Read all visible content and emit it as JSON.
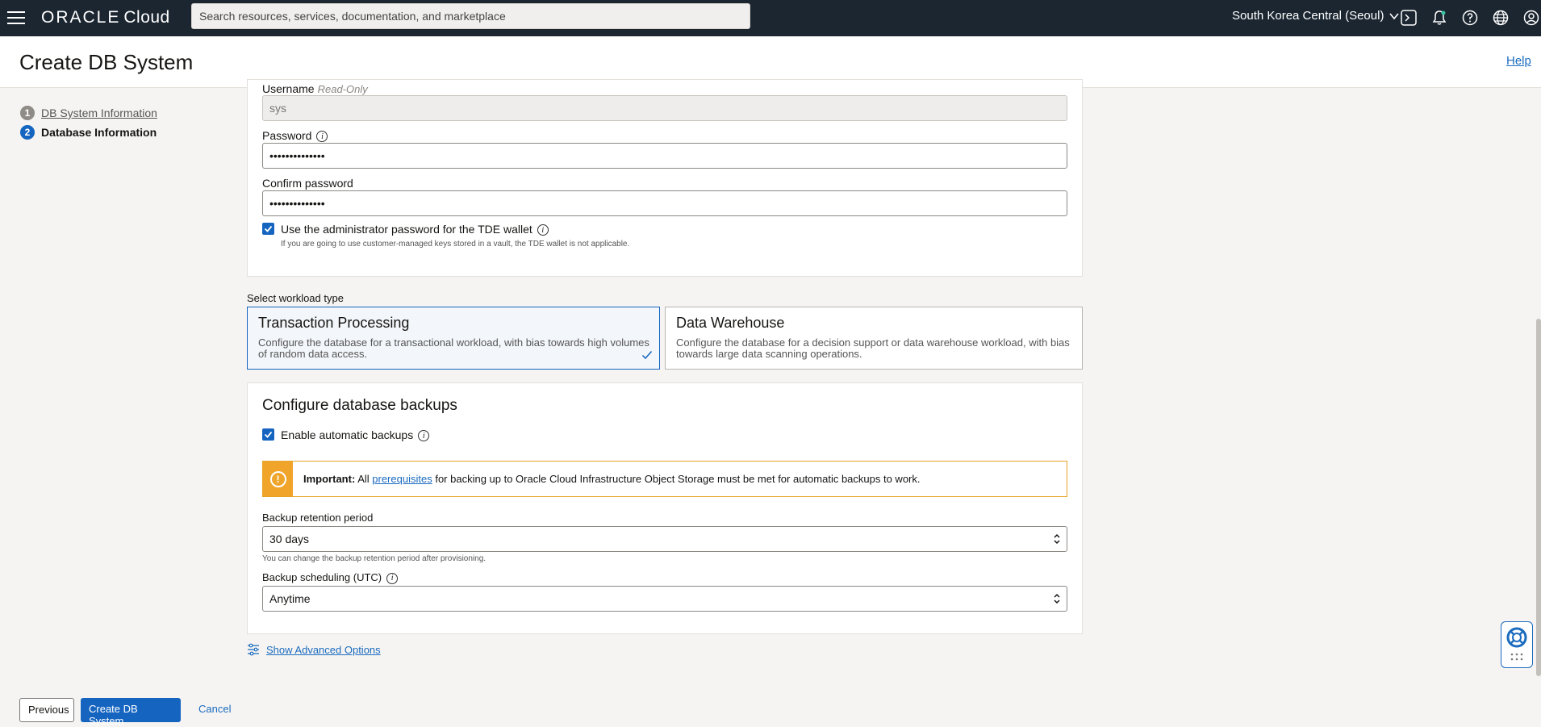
{
  "topbar": {
    "brand_oracle": "ORACLE",
    "brand_cloud": "Cloud",
    "search_placeholder": "Search resources, services, documentation, and marketplace",
    "region": "South Korea Central (Seoul)"
  },
  "header": {
    "title": "Create DB System",
    "help": "Help"
  },
  "steps": [
    {
      "num": "1",
      "label": "DB System Information"
    },
    {
      "num": "2",
      "label": "Database Information"
    }
  ],
  "admin": {
    "username_label": "Username",
    "username_note": "Read-Only",
    "username_value": "sys",
    "password_label": "Password",
    "password_value": "••••••••••••••",
    "confirm_label": "Confirm password",
    "confirm_value": "••••••••••••••",
    "tde_checkbox_label": "Use the administrator password for the TDE wallet",
    "tde_hint": "If you are going to use customer-managed keys stored in a vault, the TDE wallet is not applicable."
  },
  "workload": {
    "label": "Select workload type",
    "options": [
      {
        "title": "Transaction Processing",
        "desc_line1": "Configure the database for a transactional workload, with bias towards high volumes",
        "desc_line2": "of random data access."
      },
      {
        "title": "Data Warehouse",
        "desc_line1": "Configure the database for a decision support or data warehouse workload, with bias",
        "desc_line2": "towards large data scanning operations."
      }
    ]
  },
  "backups": {
    "title": "Configure database backups",
    "enable_label": "Enable automatic backups",
    "alert_strong": "Important:",
    "alert_pre": "All",
    "alert_link": "prerequisites",
    "alert_post": "for backing up to Oracle Cloud Infrastructure Object Storage must be met for automatic backups to work.",
    "retention_label": "Backup retention period",
    "retention_value": "30 days",
    "retention_hint": "You can change the backup retention period after provisioning.",
    "scheduling_label": "Backup scheduling (UTC)",
    "scheduling_value": "Anytime"
  },
  "advanced": "Show Advanced Options",
  "buttons": {
    "previous": "Previous",
    "create": "Create DB System",
    "cancel": "Cancel"
  },
  "colors": {
    "topbar": "#1b2631",
    "accent": "#1565c0",
    "warning": "#f0a52a"
  }
}
